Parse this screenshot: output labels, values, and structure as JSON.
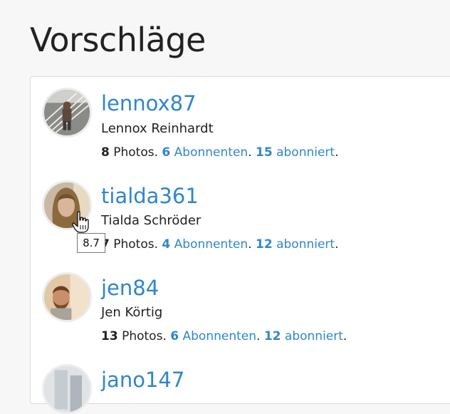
{
  "page": {
    "title": "Vorschläge"
  },
  "users": [
    {
      "username": "lennox87",
      "fullname": "Lennox Reinhardt",
      "photos": "8",
      "photos_label": "Photos",
      "followers": "6",
      "followers_label": "Abonnenten",
      "following": "15",
      "following_label": "abonniert",
      "avatar_icon": "avatar-photo-man-stairs"
    },
    {
      "username": "tialda361",
      "fullname": "Tialda Schröder",
      "photos": "7",
      "photos_label": "Photos",
      "followers": "4",
      "followers_label": "Abonnenten",
      "following": "12",
      "following_label": "abonniert",
      "avatar_icon": "avatar-photo-woman"
    },
    {
      "username": "jen84",
      "fullname": "Jen Körtig",
      "photos": "13",
      "photos_label": "Photos",
      "followers": "6",
      "followers_label": "Abonnenten",
      "following": "12",
      "following_label": "abonniert",
      "avatar_icon": "avatar-photo-man-beard"
    },
    {
      "username": "jano147",
      "avatar_icon": "avatar-photo-building"
    }
  ],
  "tooltip": {
    "text": "8.7"
  },
  "cursor": {
    "icon": "hand-pointer-icon"
  }
}
